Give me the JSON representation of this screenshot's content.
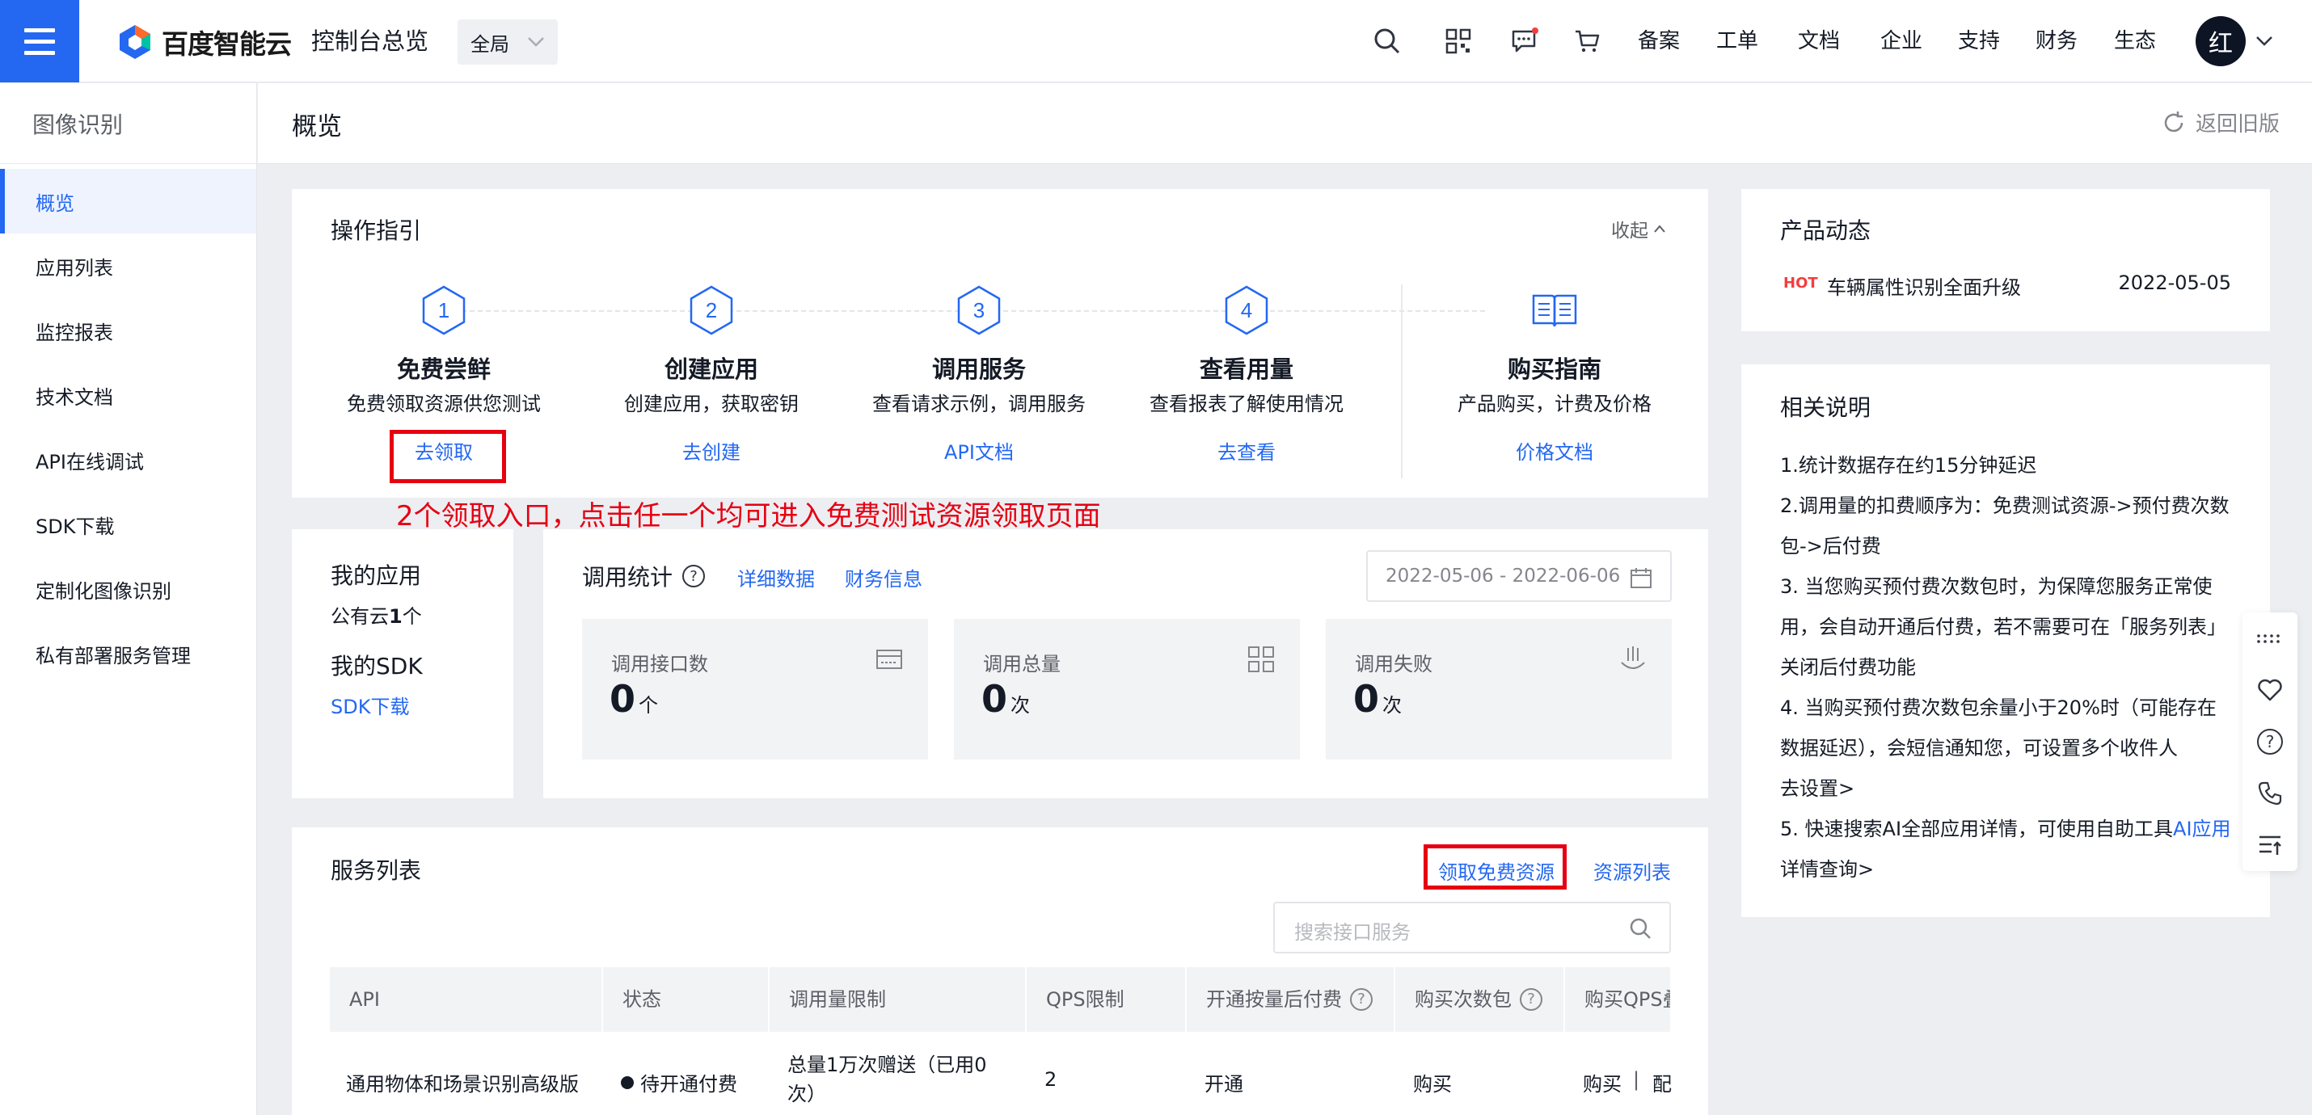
{
  "topbar": {
    "logo_text": "百度智能云",
    "console_title": "控制台总览",
    "region": "全局",
    "nav": [
      "备案",
      "工单",
      "文档",
      "企业",
      "支持",
      "财务",
      "生态"
    ],
    "avatar_text": "红",
    "icons": [
      "search-icon",
      "qrcode-icon",
      "message-icon",
      "cart-icon"
    ],
    "brand_color": "#2468f2"
  },
  "sidebar": {
    "title": "图像识别",
    "items": [
      "概览",
      "应用列表",
      "监控报表",
      "技术文档",
      "API在线调试",
      "SDK下载",
      "定制化图像识别",
      "私有部署服务管理"
    ],
    "active": "概览"
  },
  "header": {
    "title": "概览",
    "back": "返回旧版"
  },
  "guide": {
    "title": "操作指引",
    "collapse": "收起",
    "steps": [
      {
        "num": "1",
        "name": "免费尝鲜",
        "desc": "免费领取资源供您测试",
        "link": "去领取"
      },
      {
        "num": "2",
        "name": "创建应用",
        "desc": "创建应用，获取密钥",
        "link": "去创建"
      },
      {
        "num": "3",
        "name": "调用服务",
        "desc": "查看请求示例，调用服务",
        "link": "API文档"
      },
      {
        "num": "4",
        "name": "查看用量",
        "desc": "查看报表了解使用情况",
        "link": "去查看"
      }
    ],
    "buy": {
      "name": "购买指南",
      "desc": "产品购买，计费及价格",
      "link": "价格文档"
    }
  },
  "annotation": "2个领取入口，点击任一个均可进入免费测试资源领取页面",
  "my_apps": {
    "title": "我的应用",
    "cloud_prefix": "公有云",
    "cloud_count": "1",
    "cloud_suffix": "个",
    "sdk_title": "我的SDK",
    "sdk_link": "SDK下载"
  },
  "stats": {
    "title": "调用统计",
    "detail_link": "详细数据",
    "finance_link": "财务信息",
    "date_range": "2022-05-06 - 2022-06-06",
    "boxes": [
      {
        "label": "调用接口数",
        "value": "0",
        "unit": "个"
      },
      {
        "label": "调用总量",
        "value": "0",
        "unit": "次"
      },
      {
        "label": "调用失败",
        "value": "0",
        "unit": "次"
      }
    ]
  },
  "services": {
    "title": "服务列表",
    "free_link": "领取免费资源",
    "resources_link": "资源列表",
    "search_placeholder": "搜索接口服务",
    "columns": [
      "API",
      "状态",
      "调用量限制",
      "QPS限制",
      "开通按量后付费",
      "购买次数包",
      "购买QPS叠"
    ],
    "rows": [
      {
        "api": "通用物体和场景识别高级版",
        "status": "待开通付费",
        "limit_line1": "总量1万次赠送（已用0",
        "limit_line2": "次）",
        "qps": "2",
        "open": "开通",
        "buy": "购买",
        "qps_buy": "购买",
        "qps_config": "配"
      }
    ]
  },
  "news": {
    "title": "产品动态",
    "items": [
      {
        "tag": "HOT",
        "text": "车辆属性识别全面升级",
        "date": "2022-05-05"
      }
    ]
  },
  "notes": {
    "title": "相关说明",
    "n1": "1.统计数据存在约15分钟延迟",
    "n2a": "2.调用量的扣费顺序为：免费测试资源->预付费次数",
    "n2b": "包->后付费",
    "n3a": "3. 当您购买预付费次数包时，为保障您服务正常使",
    "n3b": "用，会自动开通后付费，若不需要可在「服务列表」",
    "n3c": "关闭后付费功能",
    "n4a": "4. 当购买预付费次数包余量小于20%时（可能存在",
    "n4b": "数据延迟），会短信通知您，可设置多个收件人",
    "n4link": "去设置>",
    "n5a": "5. 快速搜索AI全部应用详情，可使用自助工具",
    "n5link1": "AI应用",
    "n5link2": "详情查询>"
  }
}
